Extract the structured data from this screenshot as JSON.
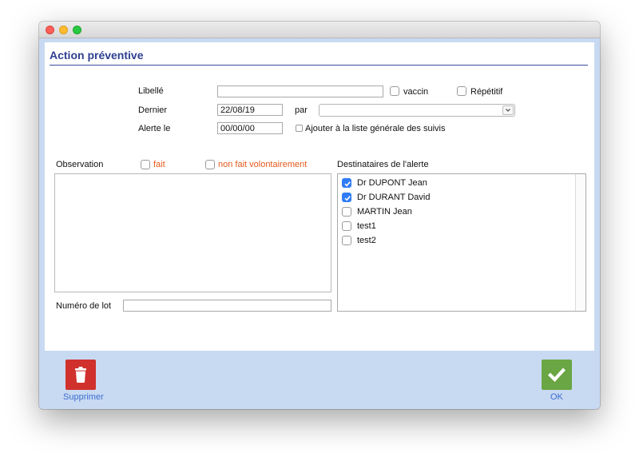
{
  "dialog": {
    "title": "Action préventive"
  },
  "form": {
    "libelle_label": "Libellé",
    "libelle_value": "",
    "vaccin_label": "vaccin",
    "vaccin_checked": false,
    "repetitif_label": "Répétitif",
    "repetitif_checked": false,
    "dernier_label": "Dernier",
    "dernier_value": "22/08/19",
    "par_label": "par",
    "par_value": "",
    "alerte_label": "Alerte le",
    "alerte_value": "00/00/00",
    "ajouter_label": "Ajouter à la liste générale des suivis",
    "ajouter_checked": false
  },
  "observation": {
    "label": "Observation",
    "fait_label": "fait",
    "fait_checked": false,
    "non_fait_label": "non fait volontairement",
    "non_fait_checked": false,
    "text": ""
  },
  "lot": {
    "label": "Numéro de lot",
    "value": ""
  },
  "recipients": {
    "label": "Destinataires de l'alerte",
    "items": [
      {
        "name": "Dr DUPONT Jean",
        "checked": true
      },
      {
        "name": "Dr DURANT David",
        "checked": true
      },
      {
        "name": "MARTIN Jean",
        "checked": false
      },
      {
        "name": "test1",
        "checked": false
      },
      {
        "name": "test2",
        "checked": false
      }
    ]
  },
  "footer": {
    "delete_label": "Supprimer",
    "delete_icon": "trash-icon",
    "ok_label": "OK",
    "ok_icon": "checkmark-icon"
  },
  "colors": {
    "title": "#2e3f91",
    "accent_orange": "#e55a1c",
    "delete_button": "#d0312d",
    "ok_button": "#6aa644",
    "checkbox_checked": "#2f7cf6",
    "footer_background": "#c8d9f2"
  }
}
